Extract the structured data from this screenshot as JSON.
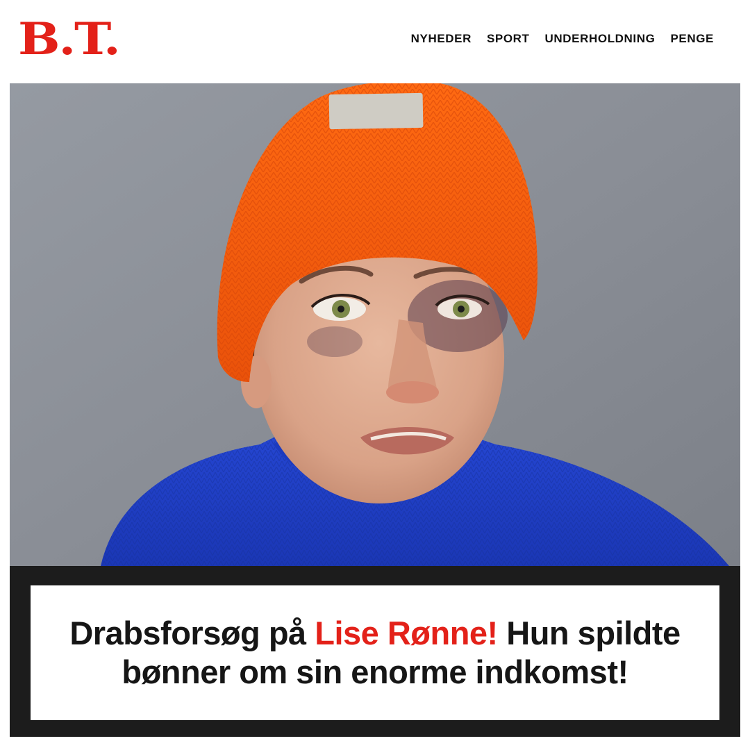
{
  "brand": {
    "logo_text": "B.T.",
    "logo_color": "#e32119"
  },
  "nav": {
    "items": [
      {
        "label": "NYHEDER"
      },
      {
        "label": "SPORT"
      },
      {
        "label": "UNDERHOLDNING"
      },
      {
        "label": "PENGE"
      }
    ]
  },
  "headline": {
    "part1": "Drabsforsøg på ",
    "highlight": "Lise Rønne!",
    "part2": " Hun spildte bønner om sin enorme indkomst!",
    "text_color": "#161616",
    "highlight_color": "#e32119",
    "frame_color": "#1c1c1c"
  },
  "hero": {
    "subject": "portrait-photo",
    "hat_color": "#f25a0c",
    "sweater_color": "#1f40c6",
    "background_color": "#8a8e96"
  }
}
